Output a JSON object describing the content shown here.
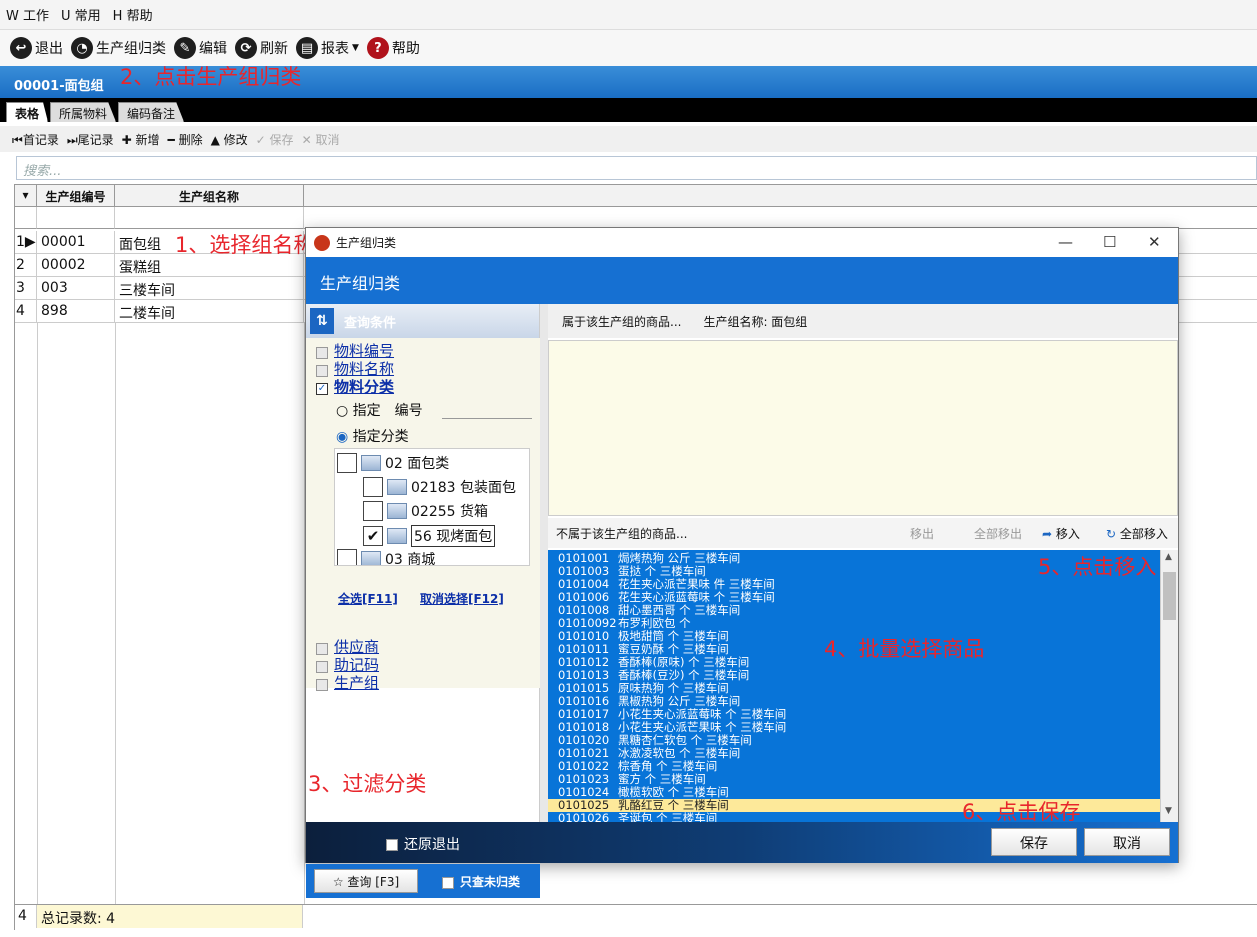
{
  "menu": [
    "W 工作",
    "U 常用",
    "H 帮助"
  ],
  "toolbar": {
    "exit": "退出",
    "classify": "生产组归类",
    "edit": "编辑",
    "refresh": "刷新",
    "report": "报表",
    "help": "帮助"
  },
  "title": "00001-面包组",
  "tabs": [
    "表格",
    "所属物料",
    "编码备注"
  ],
  "nav": {
    "first": "首记录",
    "last": "尾记录",
    "add": "新增",
    "delete": "删除",
    "modify": "修改",
    "save": "保存",
    "cancel": "取消"
  },
  "search_placeholder": "搜索...",
  "grid": {
    "col1": "生产组编号",
    "col2": "生产组名称",
    "rows": [
      {
        "idx": "1",
        "code": "00001",
        "name": "面包组"
      },
      {
        "idx": "2",
        "code": "00002",
        "name": "蛋糕组"
      },
      {
        "idx": "3",
        "code": "003",
        "name": "三楼车间"
      },
      {
        "idx": "4",
        "code": "898",
        "name": "二楼车间"
      }
    ],
    "footer_idx": "4",
    "footer_text": "总记录数: 4"
  },
  "annotations": {
    "a1": "1、选择组名称",
    "a2": "2、点击生产组归类",
    "a3": "3、过滤分类",
    "a4": "4、批量选择商品",
    "a5": "5、点击移入",
    "a6": "6、点击保存"
  },
  "dialog": {
    "window_title": "生产组归类",
    "header": "生产组归类",
    "query_title": "查询条件",
    "filters": [
      {
        "label": "物料编号",
        "checked": false
      },
      {
        "label": "物料名称",
        "checked": false
      },
      {
        "label": "物料分类",
        "checked": true
      }
    ],
    "radio_specify": "指定",
    "radio_code": "编号",
    "radio_category": "指定分类",
    "tree": [
      "02 面包类",
      "02183 包装面包",
      "02255 货箱",
      "56 现烤面包",
      "03 商城"
    ],
    "select_all": "全选[F11]",
    "deselect": "取消选择[F12]",
    "filters2": [
      "供应商",
      "助记码",
      "生产组"
    ],
    "query_btn": "查询 [F3]",
    "only_unclassified": "只查未归类",
    "belongs_label": "属于该生产组的商品...",
    "group_name_label": "生产组名称: 面包组",
    "not_belongs_label": "不属于该生产组的商品...",
    "move_out": "移出",
    "move_all_out": "全部移出",
    "move_in": "移入",
    "move_all_in": "全部移入",
    "items": [
      {
        "code": "0101001",
        "name": "焗烤热狗 公斤 三楼车间"
      },
      {
        "code": "0101003",
        "name": "蛋挞 个 三楼车间"
      },
      {
        "code": "0101004",
        "name": "花生夹心派芒果味 件 三楼车间"
      },
      {
        "code": "0101006",
        "name": "花生夹心派蓝莓味 个 三楼车间"
      },
      {
        "code": "0101008",
        "name": "甜心墨西哥 个 三楼车间"
      },
      {
        "code": "01010092",
        "name": "布罗利欧包 个"
      },
      {
        "code": "0101010",
        "name": "极地甜筒 个 三楼车间"
      },
      {
        "code": "0101011",
        "name": "蜜豆奶酥 个 三楼车间"
      },
      {
        "code": "0101012",
        "name": "香酥棒(原味) 个 三楼车间"
      },
      {
        "code": "0101013",
        "name": "香酥棒(豆沙) 个 三楼车间"
      },
      {
        "code": "0101015",
        "name": "原味热狗 个 三楼车间"
      },
      {
        "code": "0101016",
        "name": "黑椒热狗 公斤 三楼车间"
      },
      {
        "code": "0101017",
        "name": "小花生夹心派蓝莓味 个 三楼车间"
      },
      {
        "code": "0101018",
        "name": "小花生夹心派芒果味 个 三楼车间"
      },
      {
        "code": "0101020",
        "name": "黑糖杏仁软包 个 三楼车间"
      },
      {
        "code": "0101021",
        "name": "冰激凌软包 个 三楼车间"
      },
      {
        "code": "0101022",
        "name": "棕香角 个 三楼车间"
      },
      {
        "code": "0101023",
        "name": "蜜方 个 三楼车间"
      },
      {
        "code": "0101024",
        "name": "橄榄软欧 个 三楼车间"
      },
      {
        "code": "0101025",
        "name": "乳酪红豆 个 三楼车间"
      },
      {
        "code": "0101026",
        "name": "圣诞包 个 三楼车间"
      }
    ],
    "restore_exit": "还原退出",
    "save": "保存",
    "cancel": "取消"
  }
}
